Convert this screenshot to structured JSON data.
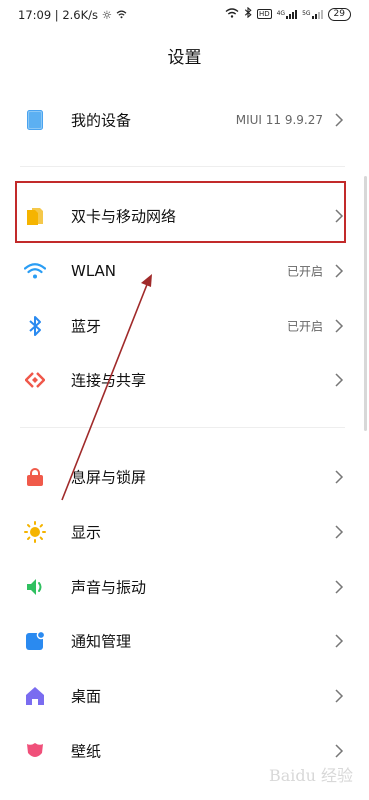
{
  "status_bar": {
    "time_speed": "17:09 | 2.6K/s",
    "signal_1": "4G",
    "signal_2": "5G",
    "battery": "29"
  },
  "title": "设置",
  "items": [
    {
      "label": "我的设备",
      "value": "MIUI 11 9.9.27",
      "icon": "device-icon",
      "color": "#4aa3f0"
    },
    {
      "label": "双卡与移动网络",
      "value": "",
      "icon": "sim-card-icon",
      "color": "#f5b400"
    },
    {
      "label": "WLAN",
      "value": "已开启",
      "icon": "wifi-icon",
      "color": "#2a9df4"
    },
    {
      "label": "蓝牙",
      "value": "已开启",
      "icon": "bluetooth-icon",
      "color": "#2a8af0"
    },
    {
      "label": "连接与共享",
      "value": "",
      "icon": "connection-share-icon",
      "color": "#f0574a"
    },
    {
      "label": "息屏与锁屏",
      "value": "",
      "icon": "lock-icon",
      "color": "#f05a4a"
    },
    {
      "label": "显示",
      "value": "",
      "icon": "sun-icon",
      "color": "#f5b400"
    },
    {
      "label": "声音与振动",
      "value": "",
      "icon": "speaker-icon",
      "color": "#30c060"
    },
    {
      "label": "通知管理",
      "value": "",
      "icon": "notification-icon",
      "color": "#2a8af0"
    },
    {
      "label": "桌面",
      "value": "",
      "icon": "home-icon",
      "color": "#7a6cf0"
    },
    {
      "label": "壁纸",
      "value": "",
      "icon": "tulip-icon",
      "color": "#f0507a"
    }
  ],
  "annotation_color": "#c22a2a",
  "watermark": "Baidu 经验"
}
